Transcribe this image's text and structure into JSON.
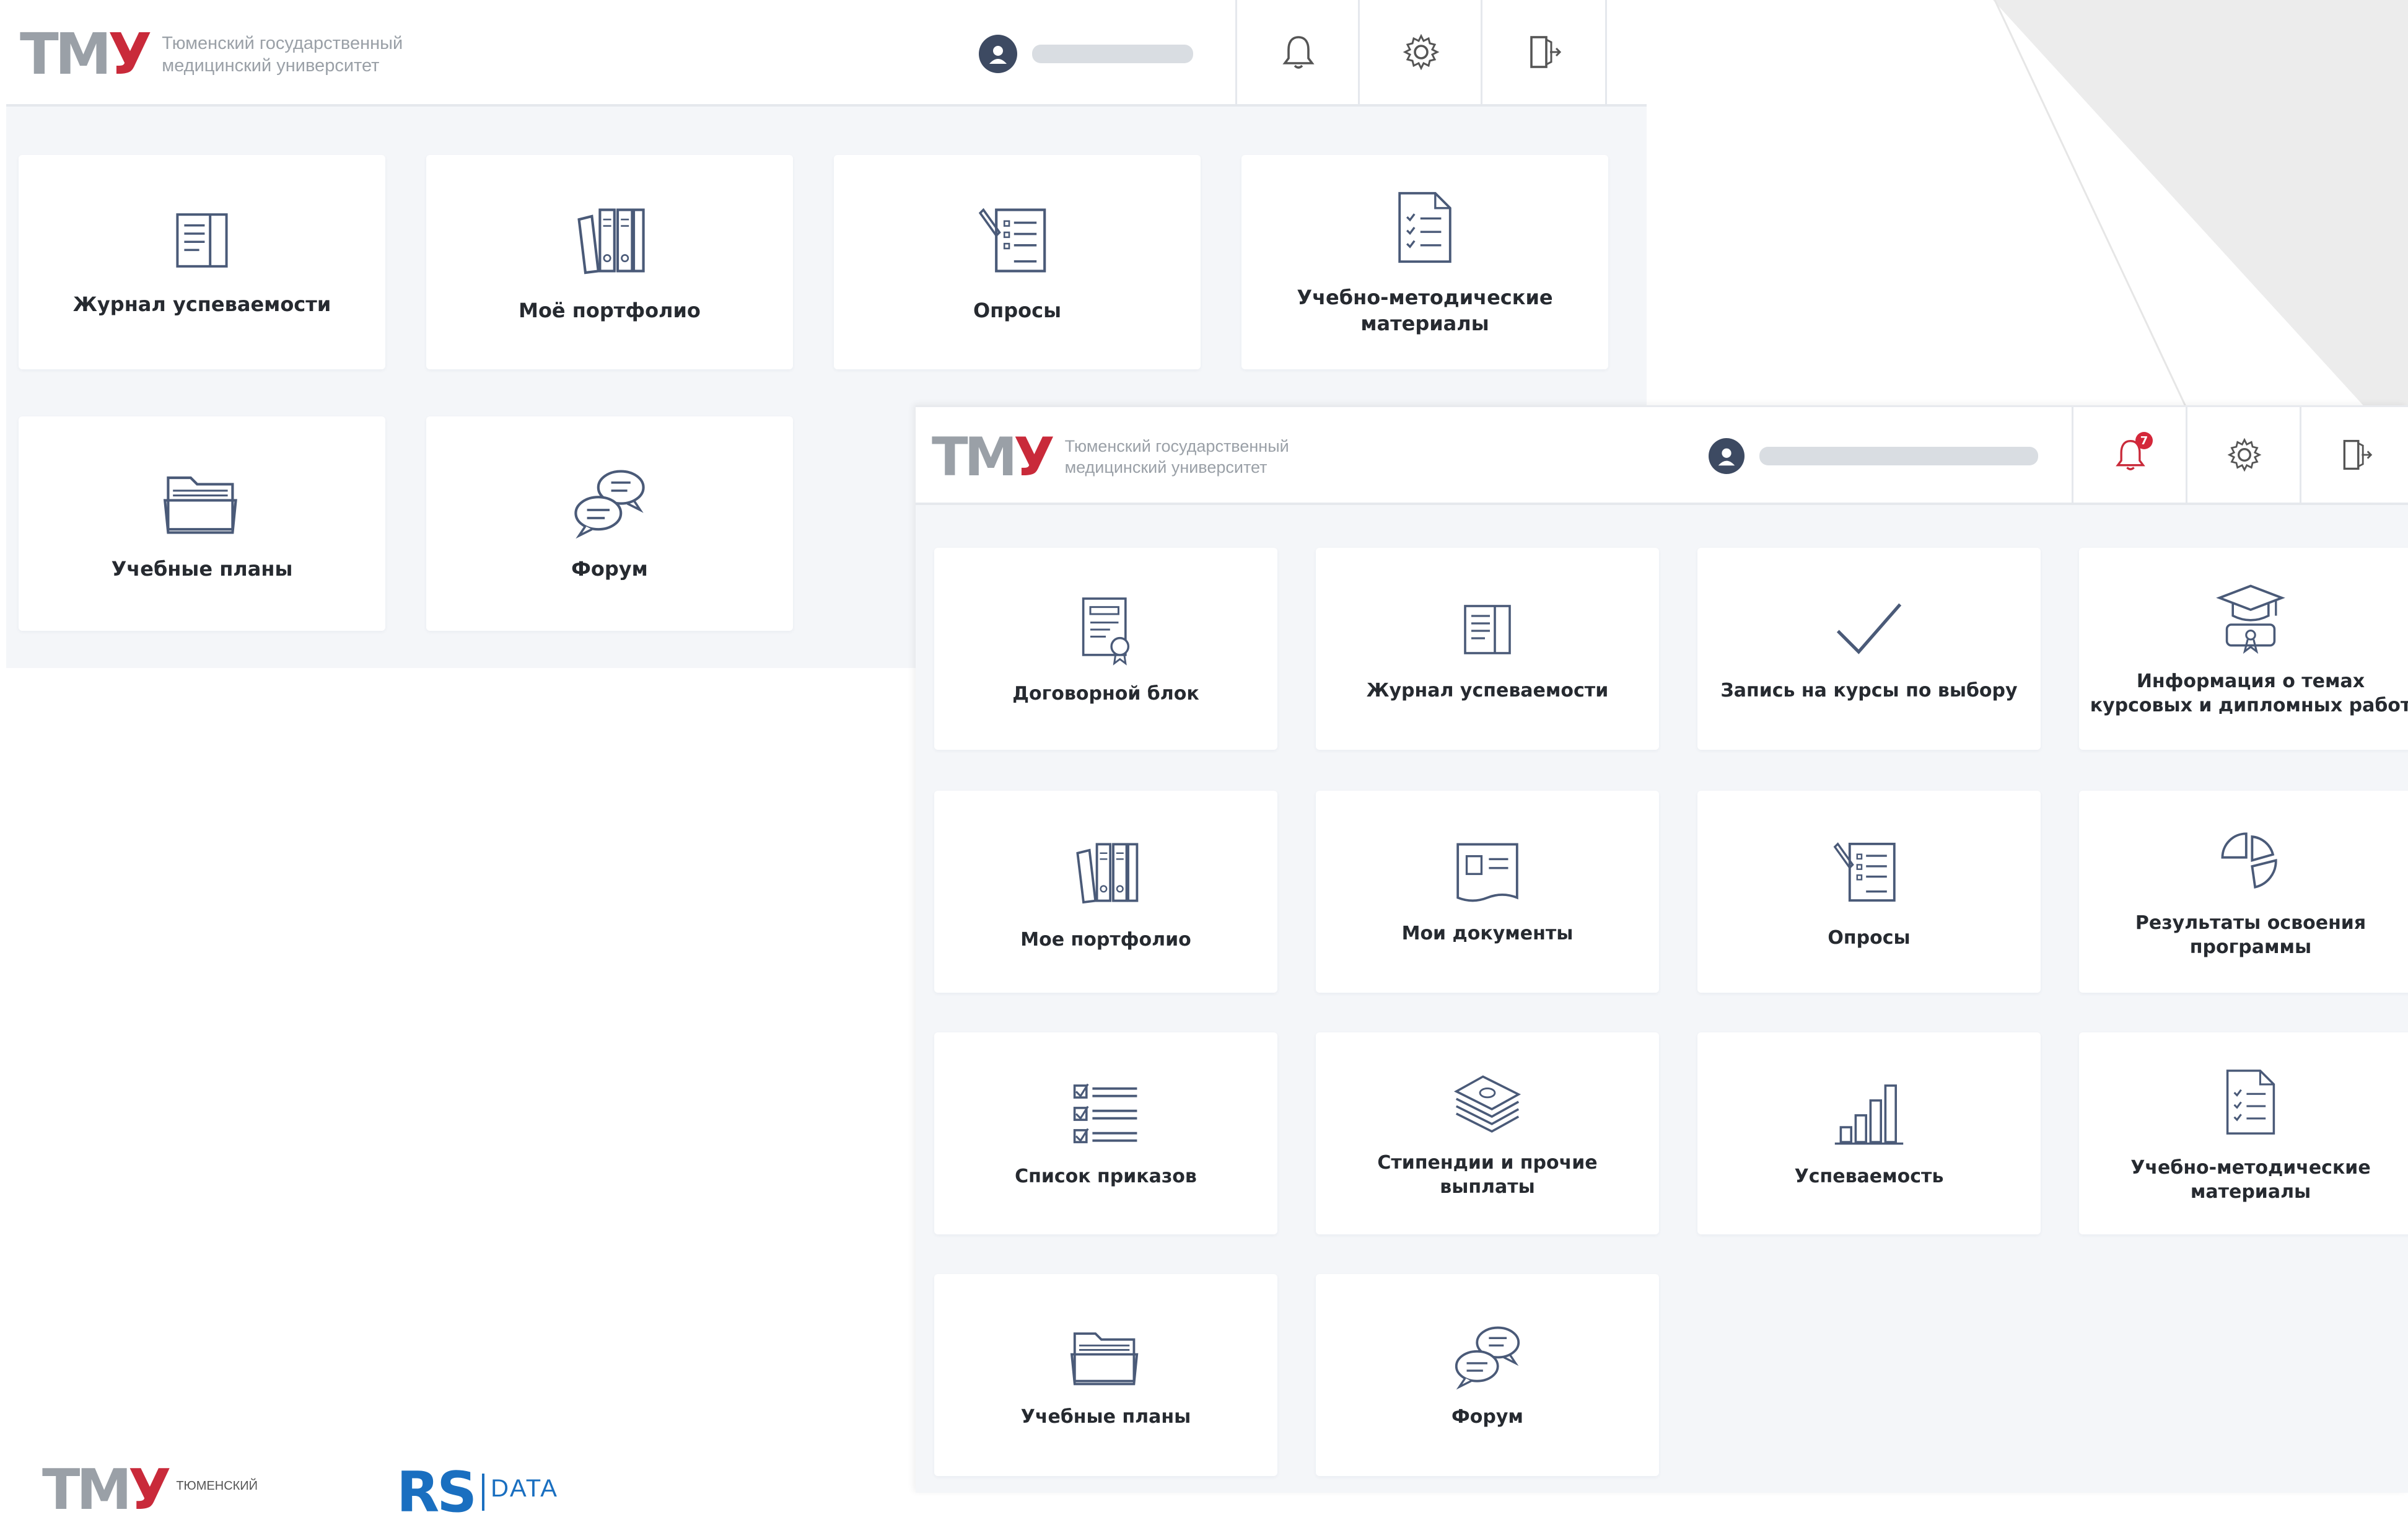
{
  "org": {
    "logo_mark_left": "ТМ",
    "logo_mark_right": "У",
    "name_line1": "Тюменский государственный",
    "name_line2": "медицинский университет"
  },
  "window_a": {
    "tiles": [
      {
        "label": "Журнал успеваемости",
        "icon": "gradebook-icon"
      },
      {
        "label": "Моё портфолио",
        "icon": "binders-icon"
      },
      {
        "label": "Опросы",
        "icon": "survey-icon"
      },
      {
        "label": "Учебно-методические материалы",
        "icon": "checklist-doc-icon"
      },
      {
        "label": "Учебные планы",
        "icon": "folder-icon"
      },
      {
        "label": "Форум",
        "icon": "chat-bubbles-icon"
      }
    ]
  },
  "window_b": {
    "notification_count": "7",
    "tiles": [
      {
        "label": "Договорной блок",
        "icon": "contract-icon"
      },
      {
        "label": "Журнал успеваемости",
        "icon": "gradebook-icon"
      },
      {
        "label": "Запись на курсы по выбору",
        "icon": "checkmark-icon"
      },
      {
        "label": "Информация о темах курсовых и дипломных работ",
        "icon": "graduation-cap-icon"
      },
      {
        "label": "Мое портфолио",
        "icon": "binders-icon"
      },
      {
        "label": "Мои документы",
        "icon": "document-card-icon"
      },
      {
        "label": "Опросы",
        "icon": "survey-icon"
      },
      {
        "label": "Результаты освоения программы",
        "icon": "pie-chart-icon"
      },
      {
        "label": "Список приказов",
        "icon": "checkbox-list-icon"
      },
      {
        "label": "Стипендии и прочие выплаты",
        "icon": "money-stack-icon"
      },
      {
        "label": "Успеваемость",
        "icon": "bar-chart-icon"
      },
      {
        "label": "Учебно-методические материалы",
        "icon": "checklist-doc-icon"
      },
      {
        "label": "Учебные планы",
        "icon": "folder-icon"
      },
      {
        "label": "Форум",
        "icon": "chat-bubbles-icon"
      }
    ]
  },
  "footer": {
    "logo1_mark_left": "ТМ",
    "logo1_mark_right": "У",
    "logo1_text": "ТЮМЕНСКИЙ",
    "logo2_mark": "RS",
    "logo2_text": "DATA"
  },
  "colors": {
    "accent_red": "#c92a3a",
    "icon_stroke": "#4a5a78",
    "background": "#f4f6f9"
  }
}
